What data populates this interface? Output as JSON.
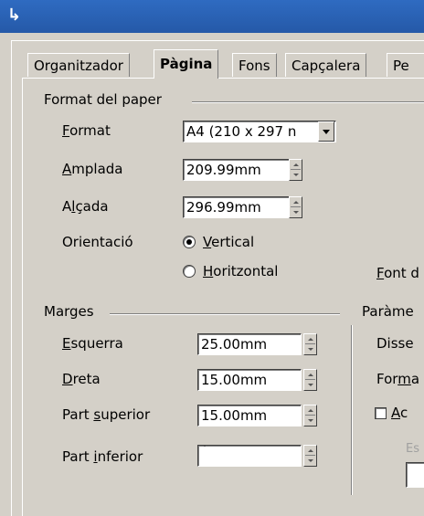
{
  "window": {
    "title_icon": "↳"
  },
  "tabs": [
    {
      "label": "Organitzador",
      "active": false
    },
    {
      "label": "Pàgina",
      "active": true
    },
    {
      "label": "Fons",
      "active": false
    },
    {
      "label": "Capçalera",
      "active": false
    },
    {
      "label": "Pe",
      "active": false
    }
  ],
  "paper_format": {
    "group_label": "Format del paper",
    "format_label": "Format",
    "format_value": "A4 (210 x 297 n",
    "width_label": "Amplada",
    "width_value": "209.99mm",
    "height_label": "Alçada",
    "height_value": "296.99mm",
    "orientation_label": "Orientació",
    "orientation_options": [
      {
        "label": "Vertical",
        "selected": true
      },
      {
        "label": "Horitzontal",
        "selected": false
      }
    ],
    "paper_source_label": "Font d"
  },
  "margins": {
    "group_label": "Marges",
    "left_label": "Esquerra",
    "left_value": "25.00mm",
    "right_label": "Dreta",
    "right_value": "15.00mm",
    "top_label": "Part superior",
    "top_value": "15.00mm",
    "bottom_label": "Part inferior",
    "bottom_value": "`"
  },
  "layout_settings": {
    "group_label": "Paràme",
    "layout_label": "Disse",
    "format_label": "Form",
    "register_label": "Ac",
    "style_label": "Es"
  }
}
